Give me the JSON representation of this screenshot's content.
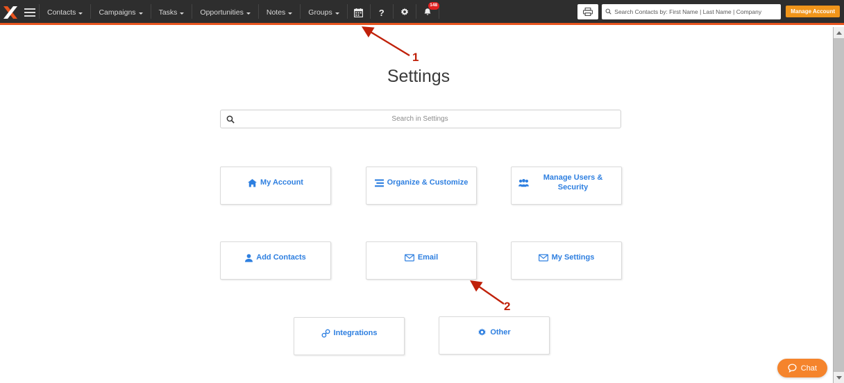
{
  "topnav": {
    "logo_icon": "x-logo-icon",
    "menu_icon": "hamburger-menu-icon",
    "items": [
      {
        "label": "Contacts",
        "has_caret": true
      },
      {
        "label": "Campaigns",
        "has_caret": true
      },
      {
        "label": "Tasks",
        "has_caret": true
      },
      {
        "label": "Opportunities",
        "has_caret": true
      },
      {
        "label": "Notes",
        "has_caret": true
      },
      {
        "label": "Groups",
        "has_caret": true
      }
    ],
    "icons": [
      {
        "name": "calendar-icon"
      },
      {
        "name": "help-icon",
        "glyph": "?"
      },
      {
        "name": "gear-icon"
      },
      {
        "name": "bell-icon",
        "badge": "148"
      }
    ],
    "print_icon": "print-icon",
    "search": {
      "icon": "search-icon",
      "placeholder": "Search Contacts by: First Name | Last Name | Company",
      "value": ""
    },
    "manage_account_label": "Manage Account"
  },
  "page": {
    "title": "Settings",
    "search": {
      "icon": "search-icon",
      "placeholder": "Search in Settings",
      "value": ""
    }
  },
  "tiles": [
    {
      "label": "My Account",
      "icon": "home-icon"
    },
    {
      "label": "Organize & Customize",
      "icon": "list-icon"
    },
    {
      "label": "Manage Users & Security",
      "icon": "users-icon"
    },
    {
      "label": "Add Contacts",
      "icon": "user-add-icon"
    },
    {
      "label": "Email",
      "icon": "envelope-icon"
    },
    {
      "label": "My Settings",
      "icon": "envelope-icon"
    },
    {
      "label": "Integrations",
      "icon": "link-icon"
    },
    {
      "label": "Other",
      "icon": "gear-icon"
    }
  ],
  "annotations": [
    {
      "number": "1",
      "target": "topnav-gear-icon"
    },
    {
      "number": "2",
      "target": "tile-email"
    }
  ],
  "chat": {
    "label": "Chat",
    "icon": "chat-bubble-icon"
  },
  "scrollbar": {
    "up_icon": "scroll-up-arrow-icon",
    "down_icon": "scroll-down-arrow-icon"
  },
  "colors": {
    "nav_bg": "#2e2e2e",
    "accent_orange": "#e8541e",
    "tile_blue": "#2e7fe0",
    "annotation_red": "#c0210a",
    "chat_orange": "#f5842c",
    "manage_account_orange": "#f0951a"
  }
}
